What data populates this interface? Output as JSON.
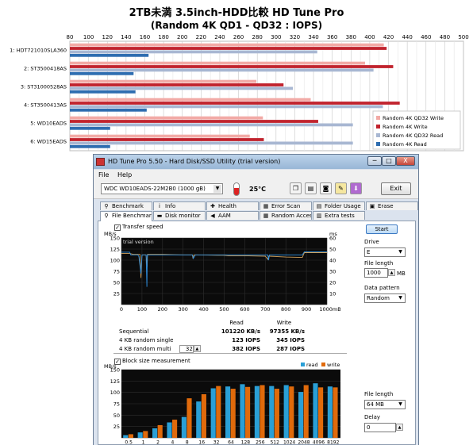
{
  "page_title": "2TB未満 3.5inch-HDD比較 HD Tune Pro",
  "page_subtitle": "(Random 4K QD1 - QD32 : IOPS)",
  "chart_data": [
    {
      "type": "bar",
      "orientation": "horizontal",
      "xlim": [
        80,
        500
      ],
      "x_ticks": [
        80,
        100,
        120,
        140,
        160,
        180,
        200,
        220,
        240,
        260,
        280,
        300,
        320,
        340,
        360,
        380,
        400,
        420,
        440,
        460,
        480,
        500
      ],
      "grid": true,
      "legend_position": "bottom-right",
      "categories": [
        "1: HDT721010SLA360",
        "2: ST3500418AS",
        "3: ST31000528AS",
        "4: ST3500413AS",
        "5: WD10EADS",
        "6: WD15EADS"
      ],
      "series": [
        {
          "name": "Random 4K QD32 Write",
          "color": "#f2aaa6",
          "values": [
            415,
            395,
            279,
            337,
            286,
            272
          ]
        },
        {
          "name": "Random 4K Write",
          "color": "#c1232d",
          "values": [
            418,
            425,
            308,
            432,
            345,
            287
          ]
        },
        {
          "name": "Random 4K QD32 Read",
          "color": "#a8b7d2",
          "values": [
            344,
            404,
            318,
            414,
            382,
            382
          ]
        },
        {
          "name": "Random 4K Read",
          "color": "#2e6db0",
          "values": [
            164,
            148,
            150,
            162,
            123,
            123
          ]
        }
      ]
    },
    {
      "type": "line",
      "y_left_label": "MB/s",
      "y_right_label": "ms",
      "ylim_left": [
        0,
        150
      ],
      "ylim_right": [
        0,
        60
      ],
      "xlim": [
        0,
        1000
      ],
      "x_unit": "mB",
      "x_ticks": [
        0,
        100,
        200,
        300,
        400,
        500,
        600,
        700,
        800,
        900,
        1000
      ],
      "y_left_ticks": [
        0,
        25,
        50,
        75,
        100,
        125,
        150
      ],
      "y_right_ticks": [
        10,
        20,
        30,
        40,
        50,
        60
      ],
      "series": [
        {
          "name": "transfer",
          "x": [
            0,
            40,
            60,
            90,
            95,
            100,
            120,
            125,
            127,
            200,
            300,
            345,
            348,
            352,
            360,
            470,
            500,
            520,
            600,
            700,
            712,
            716,
            720,
            800,
            880,
            890,
            1000
          ],
          "y": [
            115,
            115,
            113,
            113,
            60,
            112,
            112,
            85,
            113,
            113,
            112,
            112,
            104,
            112,
            112,
            111,
            111,
            110,
            110,
            109,
            102,
            109,
            109,
            107,
            106,
            117,
            117
          ]
        },
        {
          "name": "access",
          "x": [
            0,
            40,
            45,
            80,
            85,
            95,
            100,
            105,
            120,
            124,
            126,
            200,
            300,
            345,
            350,
            360,
            500,
            600,
            712,
            716,
            720,
            800,
            880,
            890,
            1000
          ],
          "y": [
            118,
            118,
            112,
            112,
            108,
            70,
            112,
            112,
            112,
            40,
            112,
            112,
            112,
            112,
            104,
            112,
            112,
            112,
            112,
            100,
            112,
            112,
            112,
            119,
            119
          ]
        }
      ]
    },
    {
      "type": "bar",
      "y_label": "MB/s",
      "ylim": [
        0,
        150
      ],
      "y_ticks": [
        0,
        25,
        50,
        75,
        100,
        125,
        150
      ],
      "categories": [
        "0.5",
        "1",
        "2",
        "4",
        "8",
        "16",
        "32",
        "64",
        "128",
        "256",
        "512",
        "1024",
        "2048",
        "4096",
        "8192"
      ],
      "series": [
        {
          "name": "read",
          "color": "#2a9fd6",
          "values": [
            6,
            12,
            21,
            34,
            46,
            80,
            109,
            113,
            118,
            114,
            114,
            116,
            101,
            120,
            113
          ]
        },
        {
          "name": "write",
          "color": "#e06a0b",
          "values": [
            8,
            15,
            28,
            40,
            87,
            96,
            114,
            108,
            112,
            116,
            108,
            113,
            116,
            111,
            111
          ]
        }
      ]
    }
  ],
  "window": {
    "title": "HD Tune Pro 5.50 - Hard Disk/SSD Utility (trial version)",
    "minimize": "─",
    "maximize": "□",
    "close": "X",
    "menu": [
      "File",
      "Help"
    ],
    "drive": "WDC WD10EADS-22M2B0 (1000 gB)",
    "temperature": "25°C",
    "exit_label": "Exit",
    "tabs_row1": [
      {
        "label": "Benchmark",
        "icon": "benchmark-icon",
        "glyph": "⚲"
      },
      {
        "label": "Info",
        "icon": "info-icon",
        "glyph": "i"
      },
      {
        "label": "Health",
        "icon": "health-icon",
        "glyph": "✚"
      },
      {
        "label": "Error Scan",
        "icon": "error-scan-icon",
        "glyph": "▦"
      },
      {
        "label": "Folder Usage",
        "icon": "folder-icon",
        "glyph": "▤"
      },
      {
        "label": "Erase",
        "icon": "erase-icon",
        "glyph": "▣"
      }
    ],
    "tabs_row2": [
      {
        "label": "File Benchmark",
        "icon": "file-benchmark-icon",
        "glyph": "⚲"
      },
      {
        "label": "Disk monitor",
        "icon": "disk-monitor-icon",
        "glyph": "▬"
      },
      {
        "label": "AAM",
        "icon": "speaker-icon",
        "glyph": "◀"
      },
      {
        "label": "Random Access",
        "icon": "random-access-icon",
        "glyph": "▦"
      },
      {
        "label": "Extra tests",
        "icon": "extra-tests-icon",
        "glyph": "▥"
      }
    ],
    "transfer_speed_label": "Transfer speed",
    "transfer_speed_checked": "✓",
    "trial_watermark": "trial version",
    "block_size_label": "Block size measurement",
    "block_size_checked": "✓",
    "start_label": "Start",
    "drive_label": "Drive",
    "drive_value": "E",
    "file_length_label": "File length",
    "file_length_value": "1000",
    "file_length_unit": "MB",
    "data_pattern_label": "Data pattern",
    "data_pattern_value": "Random",
    "file_length2_label": "File length",
    "file_length2_value": "64 MB",
    "delay_label": "Delay",
    "delay_value": "0",
    "results": {
      "col_read": "Read",
      "col_write": "Write",
      "rows": [
        {
          "label": "Sequential",
          "read": "101220 KB/s",
          "write": "97355 KB/s"
        },
        {
          "label": "4 KB random single",
          "read": "123 IOPS",
          "write": "345 IOPS"
        },
        {
          "label": "4 KB random multi",
          "read": "382 IOPS",
          "write": "287 IOPS"
        }
      ],
      "queue_depth": "32"
    },
    "legend_read": "read",
    "legend_write": "write"
  }
}
